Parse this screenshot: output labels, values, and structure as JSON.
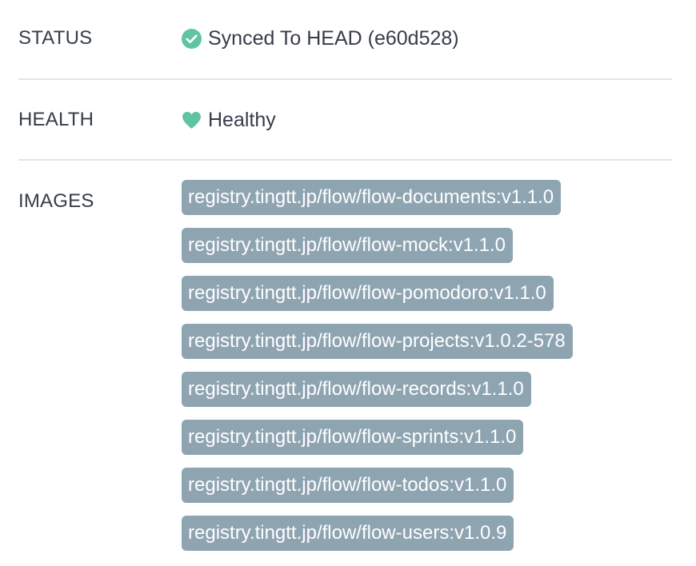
{
  "status": {
    "label": "STATUS",
    "value": "Synced To HEAD (e60d528)",
    "icon": "check-circle-icon",
    "color": "#5ec4a2"
  },
  "health": {
    "label": "HEALTH",
    "value": "Healthy",
    "icon": "heart-icon",
    "color": "#5ec4a2"
  },
  "images": {
    "label": "IMAGES",
    "tag_color": "#8fa4b1",
    "items": [
      "registry.tingtt.jp/flow/flow-documents:v1.1.0",
      "registry.tingtt.jp/flow/flow-mock:v1.1.0",
      "registry.tingtt.jp/flow/flow-pomodoro:v1.1.0",
      "registry.tingtt.jp/flow/flow-projects:v1.0.2-578",
      "registry.tingtt.jp/flow/flow-records:v1.1.0",
      "registry.tingtt.jp/flow/flow-sprints:v1.1.0",
      "registry.tingtt.jp/flow/flow-todos:v1.1.0",
      "registry.tingtt.jp/flow/flow-users:v1.0.9"
    ]
  }
}
